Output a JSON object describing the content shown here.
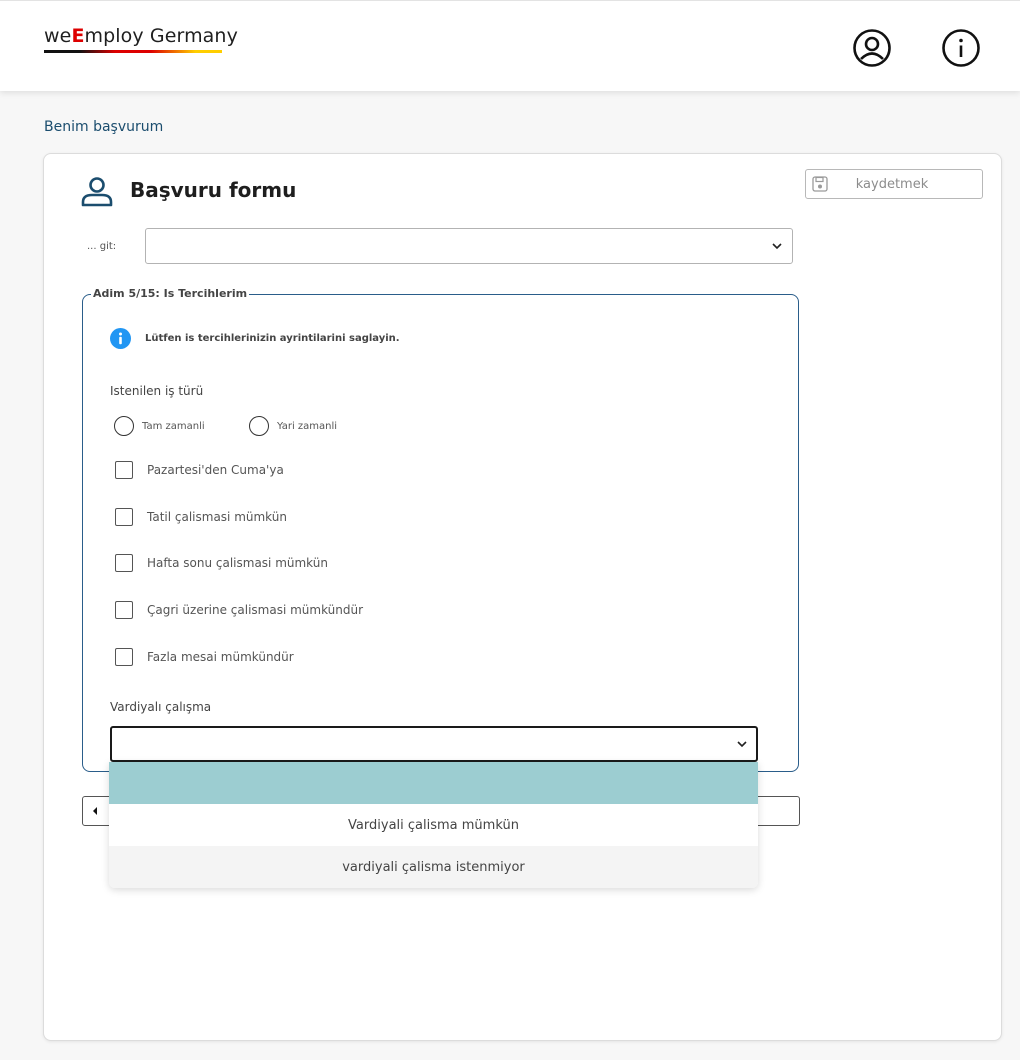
{
  "brand": {
    "pre": "we",
    "accent": "E",
    "post": "mploy Germany",
    "flag_colors": [
      "#111111",
      "#dd0000",
      "#ffce00"
    ]
  },
  "header": {
    "user_icon": "user-circle-icon",
    "info_icon": "info-circle-icon"
  },
  "breadcrumb": "Benim başvurum",
  "page": {
    "title": "Başvuru formu",
    "title_icon": "person-icon",
    "save_label": "kaydetmek",
    "save_icon": "floppy-disk-icon",
    "goto_label": "... git:",
    "goto_value": ""
  },
  "step": {
    "legend": "Adim 5/15: Is Tercihlerim",
    "info_text": "Lütfen is tercihlerinizin ayrintilarini saglayin.",
    "job_type_label": "Istenilen iş türü",
    "radios": [
      {
        "label": "Tam zamanli",
        "checked": false
      },
      {
        "label": "Yari zamanli",
        "checked": false
      }
    ],
    "checkboxes": [
      {
        "label": "Pazartesi'den Cuma'ya",
        "checked": false
      },
      {
        "label": "Tatil çalismasi mümkün",
        "checked": false
      },
      {
        "label": "Hafta sonu çalismasi mümkün",
        "checked": false
      },
      {
        "label": "Çagri üzerine çalismasi mümkündür",
        "checked": false
      },
      {
        "label": "Fazla mesai mümkündür",
        "checked": false
      }
    ],
    "shift_label": "Vardiyalı çalışma",
    "shift_value": ""
  },
  "dropdown": {
    "options": [
      {
        "label": "",
        "selected": true
      },
      {
        "label": "Vardiyali çalisma mümkün",
        "selected": false
      },
      {
        "label": "vardiyali çalisma istenmiyor",
        "selected": false
      }
    ]
  },
  "colors": {
    "accent_blue": "#1b4d6e",
    "info_blue": "#2196f3",
    "dropdown_highlight": "#9ccdd1"
  }
}
